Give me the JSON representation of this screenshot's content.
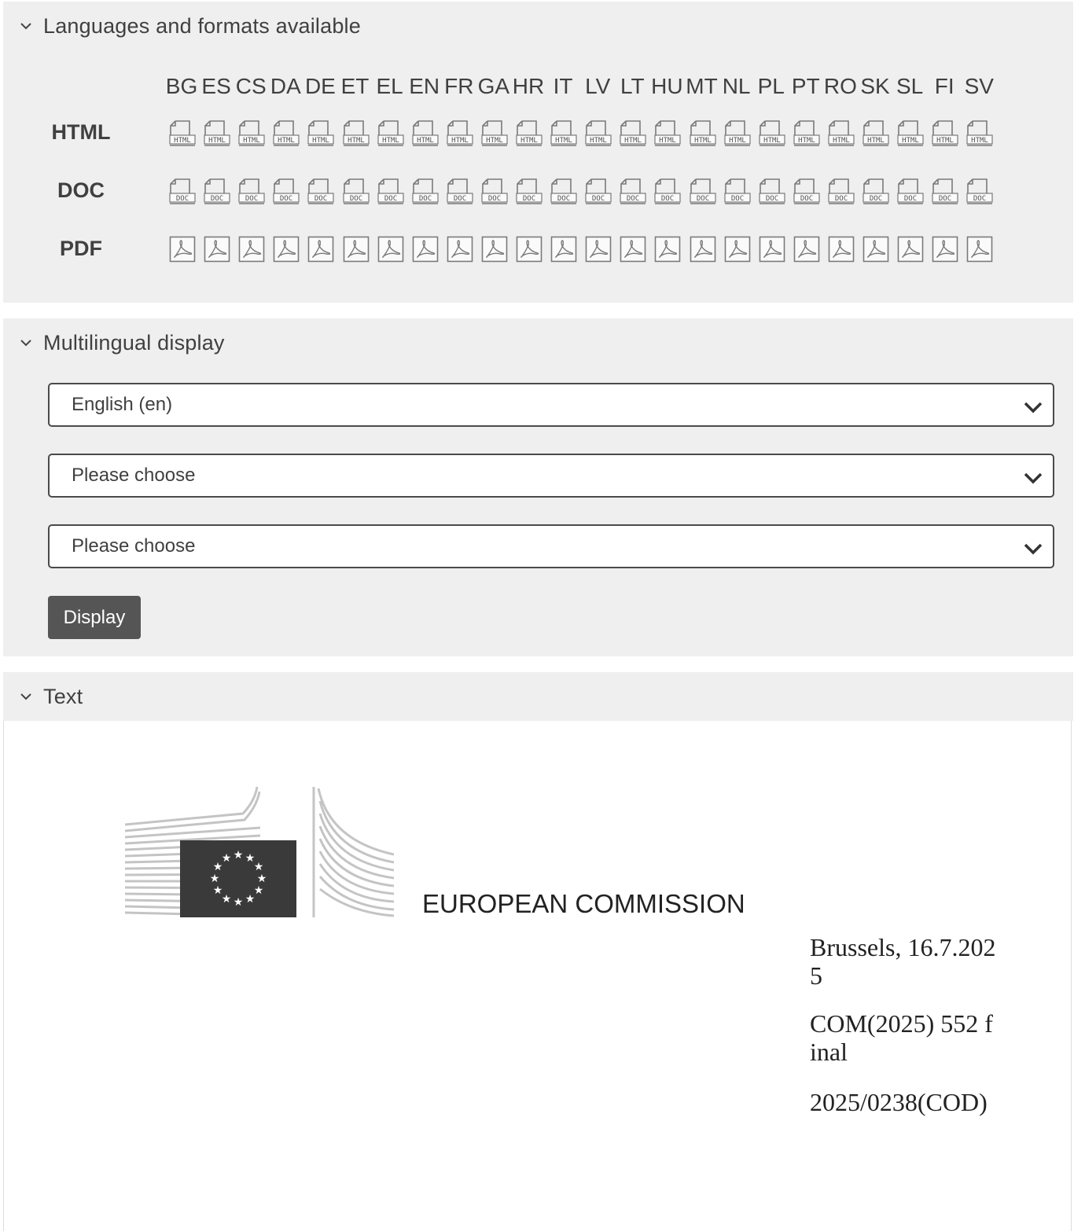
{
  "languages_panel": {
    "title": "Languages and formats available",
    "languages": [
      "BG",
      "ES",
      "CS",
      "DA",
      "DE",
      "ET",
      "EL",
      "EN",
      "FR",
      "GA",
      "HR",
      "IT",
      "LV",
      "LT",
      "HU",
      "MT",
      "NL",
      "PL",
      "PT",
      "RO",
      "SK",
      "SL",
      "FI",
      "SV"
    ],
    "formats": [
      {
        "label": "HTML",
        "icon_text": "HTML",
        "icon": "html-file-icon"
      },
      {
        "label": "DOC",
        "icon_text": "DOC",
        "icon": "doc-file-icon"
      },
      {
        "label": "PDF",
        "icon_text": "",
        "icon": "pdf-file-icon"
      }
    ]
  },
  "multilingual_panel": {
    "title": "Multilingual display",
    "selects": [
      {
        "value": "English (en)"
      },
      {
        "value": "Please choose"
      },
      {
        "value": "Please choose"
      }
    ],
    "display_button": "Display"
  },
  "text_panel": {
    "title": "Text",
    "logo_icon": "european-commission-logo",
    "organisation": "EUROPEAN COMMISSION",
    "place_date": "Brussels, 16.7.2025",
    "reference": "COM(2025) 552 final",
    "procedure": "2025/0238(COD)"
  },
  "colors": {
    "panel_bg": "#efefef",
    "button_bg": "#555555",
    "text": "#404040"
  }
}
